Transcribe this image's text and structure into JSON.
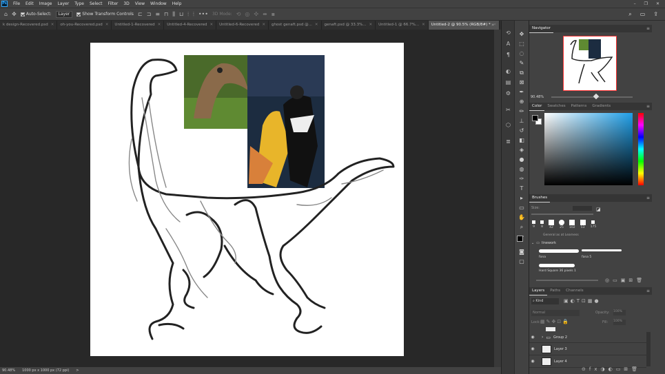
{
  "menubar": {
    "logo": "Ps",
    "items": [
      "File",
      "Edit",
      "Image",
      "Layer",
      "Type",
      "Select",
      "Filter",
      "3D",
      "View",
      "Window",
      "Help"
    ],
    "window_controls": [
      "–",
      "❐",
      "✕"
    ]
  },
  "options": {
    "auto_select_label": "Auto-Select:",
    "layer_select": "Layer",
    "show_transform_label": "Show Transform Controls",
    "mode_3d_label": "3D Mode:"
  },
  "tabs": [
    {
      "label": "k design-Recovered.psd"
    },
    {
      "label": "oh-you-Recovered.psd"
    },
    {
      "label": "Untitled-1-Recovered"
    },
    {
      "label": "Untitled-4-Recovered"
    },
    {
      "label": "Untitled-6-Recovered"
    },
    {
      "label": "ghost genaft.psd @..."
    },
    {
      "label": "genaft.psd @ 33.3%..."
    },
    {
      "label": "Untitled-1 @ 66.7%..."
    },
    {
      "label": "Untitled-2 @ 90.5% (RGB/8#) *"
    }
  ],
  "status": {
    "zoom": "90.48%",
    "doc": "1000 px x 1000 px (72 ppi)",
    "arrow": ">"
  },
  "navigator": {
    "title": "Navigator",
    "zoom": "90.48%"
  },
  "color_panel": {
    "tabs": [
      "Color",
      "Swatches",
      "Patterns",
      "Gradients"
    ]
  },
  "brushes": {
    "title": "Brushes",
    "size_label": "Size:",
    "sizes": [
      "9",
      "8",
      "42",
      "25",
      "102",
      "53",
      "175"
    ],
    "legacy_label": "General as at Learness",
    "group_name": "linework",
    "brush_a": "fona",
    "brush_b": "fana 5",
    "brush_c": "Hard Square 36 pixels 1"
  },
  "layers": {
    "tabs": [
      "Layers",
      "Paths",
      "Channels"
    ],
    "kind_label": "Kind",
    "blend_mode": "Normal",
    "opacity_label": "Opacity:",
    "opacity": "100%",
    "lock_label": "Lock:",
    "fill_label": "Fill:",
    "fill": "100%",
    "rows": [
      {
        "name": "Group 2"
      },
      {
        "name": "Layer 3"
      },
      {
        "name": "Layer 4"
      }
    ]
  },
  "colors": {
    "accent": "#31a8ff",
    "panel": "#424242",
    "canvas_bg": "#282828"
  }
}
